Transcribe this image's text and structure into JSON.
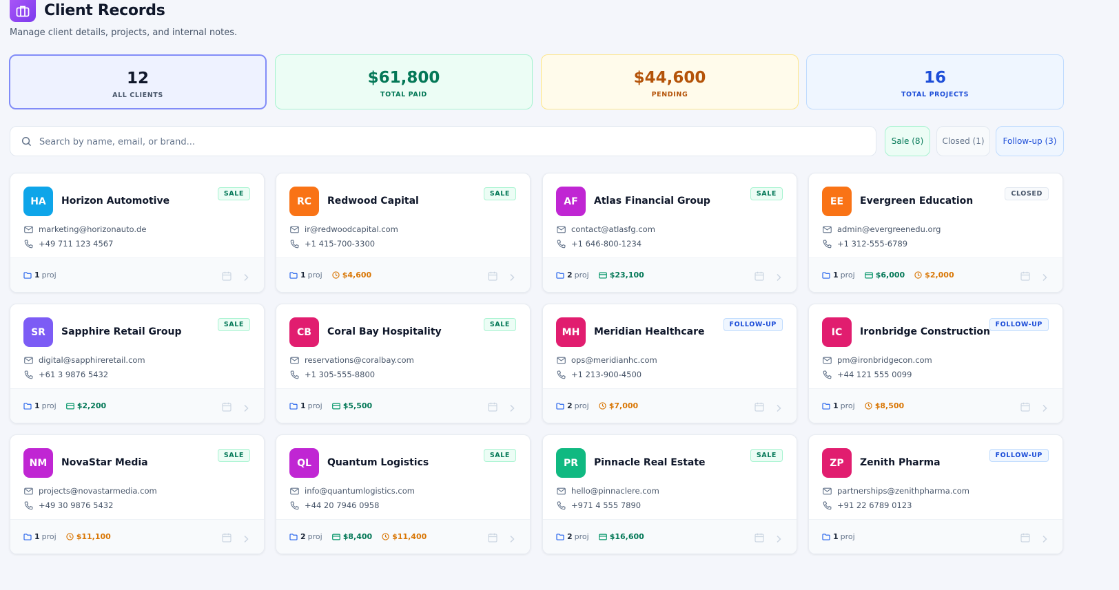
{
  "header": {
    "title": "Client Records",
    "subtitle": "Manage client details, projects, and internal notes."
  },
  "stats": [
    {
      "value": "12",
      "label": "ALL CLIENTS"
    },
    {
      "value": "$61,800",
      "label": "TOTAL PAID"
    },
    {
      "value": "$44,600",
      "label": "PENDING"
    },
    {
      "value": "16",
      "label": "TOTAL PROJECTS"
    }
  ],
  "search": {
    "placeholder": "Search by name, email, or brand...",
    "value": ""
  },
  "filters": {
    "sale": "Sale (8)",
    "closed": "Closed (1)",
    "follow_up": "Follow-up (3)"
  },
  "proj_label": "proj",
  "colors": {
    "paid": "#047857",
    "pending": "#d97706",
    "accent": "#7c3aed"
  },
  "clients": [
    {
      "initials": "HA",
      "name": "Horizon Automotive",
      "status": "SALE",
      "email": "marketing@horizonauto.de",
      "phone": "+49 711 123 4567",
      "projects": "1",
      "paid": "",
      "pending": "",
      "avatar_color": "#0ea5e9"
    },
    {
      "initials": "RC",
      "name": "Redwood Capital",
      "status": "SALE",
      "email": "ir@redwoodcapital.com",
      "phone": "+1 415-700-3300",
      "projects": "1",
      "paid": "",
      "pending": "$4,600",
      "avatar_color": "#f97316"
    },
    {
      "initials": "AF",
      "name": "Atlas Financial Group",
      "status": "SALE",
      "email": "contact@atlasfg.com",
      "phone": "+1 646-800-1234",
      "projects": "2",
      "paid": "$23,100",
      "pending": "",
      "avatar_color": "#c026d3"
    },
    {
      "initials": "EE",
      "name": "Evergreen Education",
      "status": "CLOSED",
      "email": "admin@evergreenedu.org",
      "phone": "+1 312-555-6789",
      "projects": "1",
      "paid": "$6,000",
      "pending": "$2,000",
      "avatar_color": "#f97316"
    },
    {
      "initials": "SR",
      "name": "Sapphire Retail Group",
      "status": "SALE",
      "email": "digital@sapphireretail.com",
      "phone": "+61 3 9876 5432",
      "projects": "1",
      "paid": "$2,200",
      "pending": "",
      "avatar_color": "#7c5cf5"
    },
    {
      "initials": "CB",
      "name": "Coral Bay Hospitality",
      "status": "SALE",
      "email": "reservations@coralbay.com",
      "phone": "+1 305-555-8800",
      "projects": "1",
      "paid": "$5,500",
      "pending": "",
      "avatar_color": "#e11d6f"
    },
    {
      "initials": "MH",
      "name": "Meridian Healthcare",
      "status": "FOLLOW-UP",
      "email": "ops@meridianhc.com",
      "phone": "+1 213-900-4500",
      "projects": "2",
      "paid": "",
      "pending": "$7,000",
      "avatar_color": "#e11d6f"
    },
    {
      "initials": "IC",
      "name": "Ironbridge Construction",
      "status": "FOLLOW-UP",
      "email": "pm@ironbridgecon.com",
      "phone": "+44 121 555 0099",
      "projects": "1",
      "paid": "",
      "pending": "$8,500",
      "avatar_color": "#e11d6f"
    },
    {
      "initials": "NM",
      "name": "NovaStar Media",
      "status": "SALE",
      "email": "projects@novastarmedia.com",
      "phone": "+49 30 9876 5432",
      "projects": "1",
      "paid": "",
      "pending": "$11,100",
      "avatar_color": "#c026d3"
    },
    {
      "initials": "QL",
      "name": "Quantum Logistics",
      "status": "SALE",
      "email": "info@quantumlogistics.com",
      "phone": "+44 20 7946 0958",
      "projects": "2",
      "paid": "$8,400",
      "pending": "$11,400",
      "avatar_color": "#c026d3"
    },
    {
      "initials": "PR",
      "name": "Pinnacle Real Estate",
      "status": "SALE",
      "email": "hello@pinnaclere.com",
      "phone": "+971 4 555 7890",
      "projects": "2",
      "paid": "$16,600",
      "pending": "",
      "avatar_color": "#10b981"
    },
    {
      "initials": "ZP",
      "name": "Zenith Pharma",
      "status": "FOLLOW-UP",
      "email": "partnerships@zenithpharma.com",
      "phone": "+91 22 6789 0123",
      "projects": "1",
      "paid": "",
      "pending": "",
      "avatar_color": "#e11d6f"
    }
  ]
}
